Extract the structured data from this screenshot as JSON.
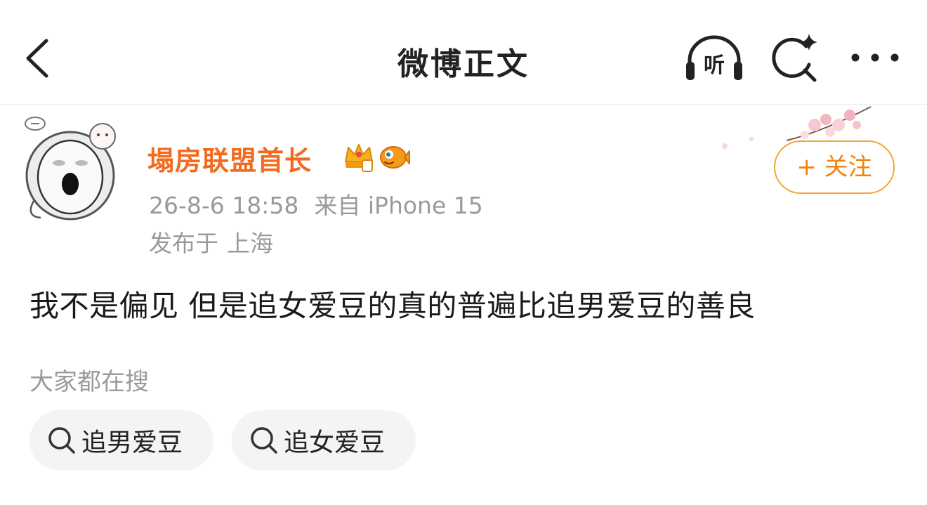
{
  "header": {
    "title": "微博正文",
    "listen_label": "听"
  },
  "post": {
    "author": "塌房联盟首长",
    "timestamp": "26-8-6 18:58",
    "source": "来自 iPhone 15",
    "location_prefix": "发布于",
    "location": "上海",
    "follow_label": "+ 关注",
    "text": "我不是偏见 但是追女爱豆的真的普遍比追男爱豆的善良"
  },
  "trending": {
    "label": "大家都在搜",
    "chips": [
      {
        "label": "追男爱豆"
      },
      {
        "label": "追女爱豆"
      }
    ]
  },
  "colors": {
    "username": "#f26a1e",
    "follow_border": "#f5a433",
    "follow_text": "#f0840f",
    "meta_text": "#9a9a9a",
    "chip_bg": "#f4f4f4"
  },
  "icons": {
    "back": "chevron-left-icon",
    "listen": "headphones-icon",
    "search": "search-sparkle-icon",
    "more": "more-dots-icon",
    "badge_1": "crown-badge-icon",
    "badge_2": "fish-badge-icon",
    "chip_search": "search-icon"
  }
}
